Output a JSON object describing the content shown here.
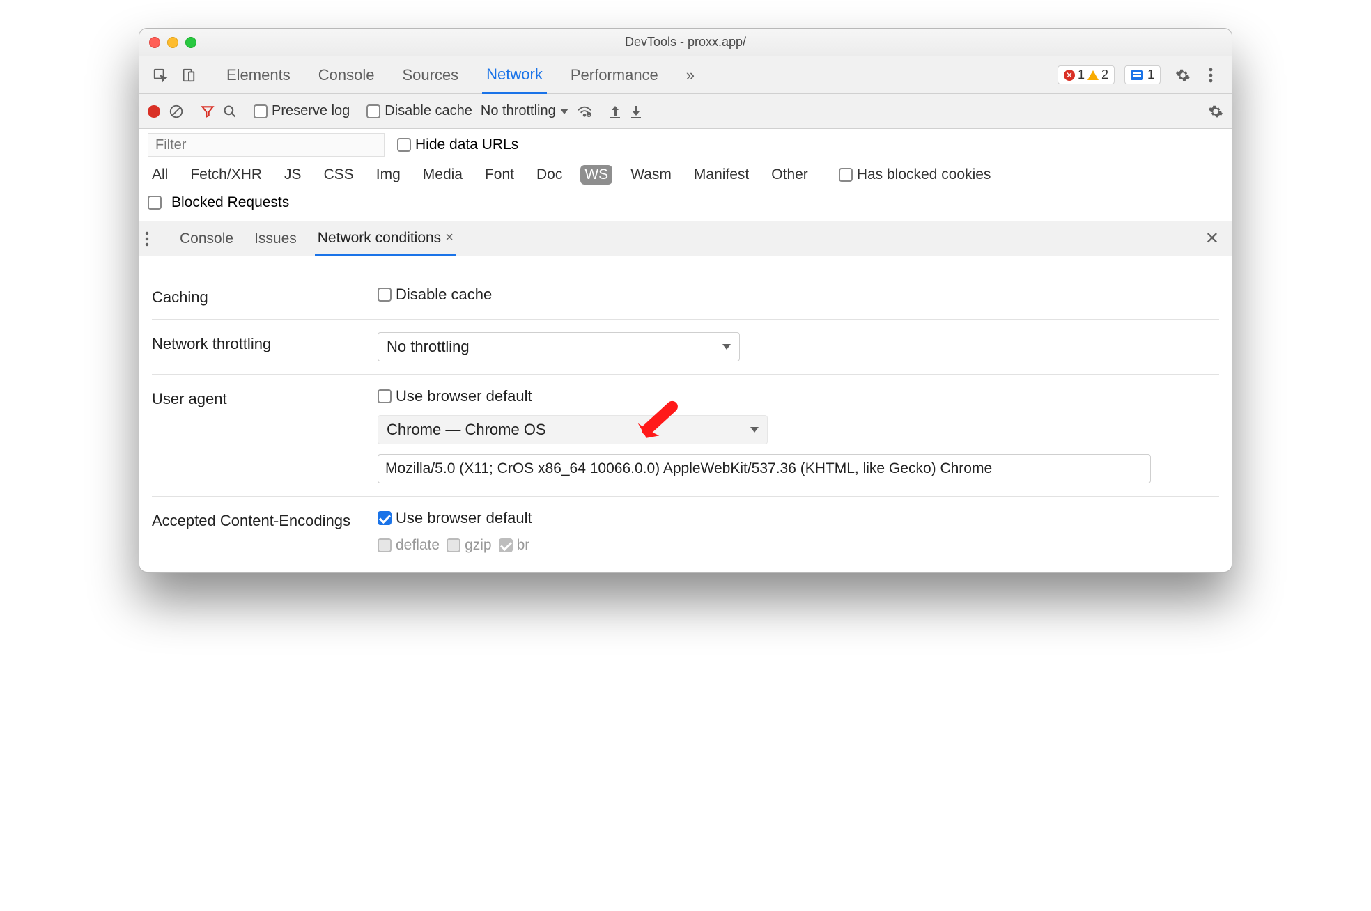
{
  "window": {
    "title": "DevTools - proxx.app/"
  },
  "main_tabs": {
    "items": [
      "Elements",
      "Console",
      "Sources",
      "Network",
      "Performance"
    ],
    "active": "Network",
    "overflow_glyph": "»"
  },
  "counters": {
    "errors": "1",
    "warnings": "2",
    "messages": "1"
  },
  "network_toolbar": {
    "preserve_log": "Preserve log",
    "disable_cache": "Disable cache",
    "throttling": "No throttling"
  },
  "filter": {
    "placeholder": "Filter",
    "hide_data_urls": "Hide data URLs",
    "types": [
      "All",
      "Fetch/XHR",
      "JS",
      "CSS",
      "Img",
      "Media",
      "Font",
      "Doc",
      "WS",
      "Wasm",
      "Manifest",
      "Other"
    ],
    "selected_type": "WS",
    "has_blocked_cookies": "Has blocked cookies",
    "blocked_requests": "Blocked Requests"
  },
  "drawer": {
    "tabs": [
      "Console",
      "Issues",
      "Network conditions"
    ],
    "active": "Network conditions"
  },
  "conditions": {
    "caching_label": "Caching",
    "caching_checkbox": "Disable cache",
    "throttling_label": "Network throttling",
    "throttling_value": "No throttling",
    "ua_label": "User agent",
    "ua_checkbox": "Use browser default",
    "ua_select": "Chrome — Chrome OS",
    "ua_string": "Mozilla/5.0 (X11; CrOS x86_64 10066.0.0) AppleWebKit/537.36 (KHTML, like Gecko) Chrome",
    "enc_label": "Accepted Content-Encodings",
    "enc_checkbox": "Use browser default",
    "enc_options": [
      "deflate",
      "gzip",
      "br"
    ]
  }
}
